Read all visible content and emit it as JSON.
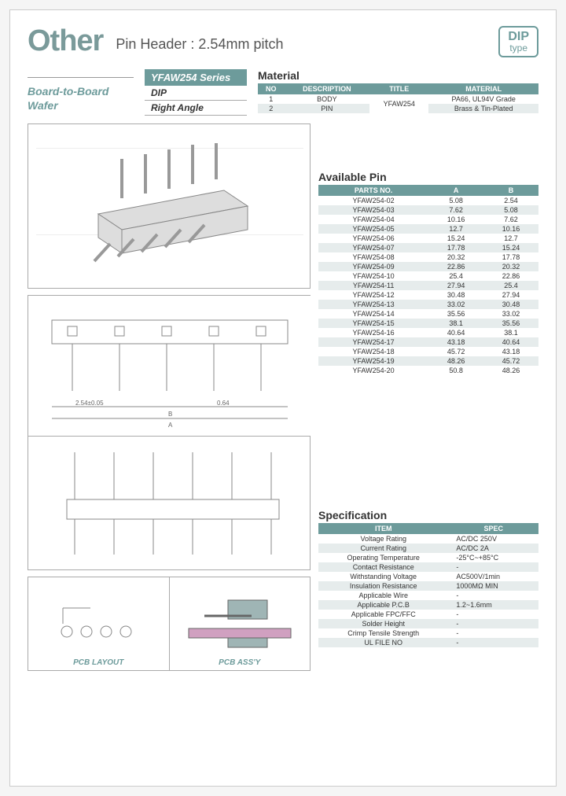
{
  "header": {
    "logo": "Other",
    "subtitle": "Pin Header : 2.54mm pitch",
    "badge_top": "DIP",
    "badge_bot": "type"
  },
  "meta": {
    "left": "Board-to-Board\nWafer",
    "series": "YFAW254 Series",
    "type1": "DIP",
    "type2": "Right Angle"
  },
  "material": {
    "title": "Material",
    "headers": [
      "NO",
      "DESCRIPTION",
      "TITLE",
      "MATERIAL"
    ],
    "rows": [
      [
        "1",
        "BODY",
        "YFAW254",
        "PA66, UL94V Grade"
      ],
      [
        "2",
        "PIN",
        "",
        "Brass & Tin-Plated"
      ]
    ]
  },
  "pins": {
    "title": "Available Pin",
    "headers": [
      "PARTS NO.",
      "A",
      "B"
    ],
    "rows": [
      [
        "YFAW254-02",
        "5.08",
        "2.54"
      ],
      [
        "YFAW254-03",
        "7.62",
        "5.08"
      ],
      [
        "YFAW254-04",
        "10.16",
        "7.62"
      ],
      [
        "YFAW254-05",
        "12.7",
        "10.16"
      ],
      [
        "YFAW254-06",
        "15.24",
        "12.7"
      ],
      [
        "YFAW254-07",
        "17.78",
        "15.24"
      ],
      [
        "YFAW254-08",
        "20.32",
        "17.78"
      ],
      [
        "YFAW254-09",
        "22.86",
        "20.32"
      ],
      [
        "YFAW254-10",
        "25.4",
        "22.86"
      ],
      [
        "YFAW254-11",
        "27.94",
        "25.4"
      ],
      [
        "YFAW254-12",
        "30.48",
        "27.94"
      ],
      [
        "YFAW254-13",
        "33.02",
        "30.48"
      ],
      [
        "YFAW254-14",
        "35.56",
        "33.02"
      ],
      [
        "YFAW254-15",
        "38.1",
        "35.56"
      ],
      [
        "YFAW254-16",
        "40.64",
        "38.1"
      ],
      [
        "YFAW254-17",
        "43.18",
        "40.64"
      ],
      [
        "YFAW254-18",
        "45.72",
        "43.18"
      ],
      [
        "YFAW254-19",
        "48.26",
        "45.72"
      ],
      [
        "YFAW254-20",
        "50.8",
        "48.26"
      ]
    ]
  },
  "spec": {
    "title": "Specification",
    "headers": [
      "ITEM",
      "SPEC"
    ],
    "rows": [
      [
        "Voltage Rating",
        "AC/DC 250V"
      ],
      [
        "Current Rating",
        "AC/DC 2A"
      ],
      [
        "Operating Temperature",
        "-25°C~+85°C"
      ],
      [
        "Contact Resistance",
        "-"
      ],
      [
        "Withstanding Voltage",
        "AC500V/1min"
      ],
      [
        "Insulation Resistance",
        "1000MΩ MIN"
      ],
      [
        "Applicable Wire",
        "-"
      ],
      [
        "Applicable P.C.B",
        "1.2~1.6mm"
      ],
      [
        "Applicable FPC/FFC",
        "-"
      ],
      [
        "Solder Height",
        "-"
      ],
      [
        "Crimp Tensile Strength",
        "-"
      ],
      [
        "UL FILE NO",
        "-"
      ]
    ]
  },
  "drawings": {
    "dim1": "2.54±0.05",
    "dim2": "0.64",
    "dimB": "B",
    "dimA": "A",
    "pcb_layout": "PCB LAYOUT",
    "pcb_assy": "PCB ASS'Y"
  }
}
